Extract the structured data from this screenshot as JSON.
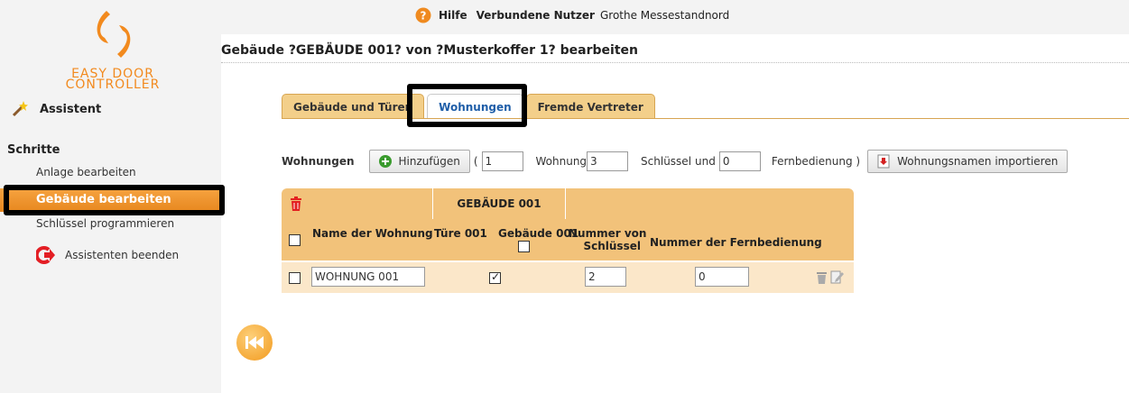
{
  "app": {
    "logo_line1": "EASY DOOR",
    "logo_line2": "CONTROLLER"
  },
  "sidebar": {
    "assistent_label": "Assistent",
    "schritte_label": "Schritte",
    "steps": [
      "Anlage bearbeiten",
      "Gebäude bearbeiten",
      "Schlüssel programmieren"
    ],
    "exit_label": "Assistenten beenden"
  },
  "topbar": {
    "help_label": "Hilfe",
    "users_label": "Verbundene Nutzer",
    "user_name": "Grothe Messestandnord"
  },
  "page": {
    "title": "Gebäude ?GEBÄUDE 001? von ?Musterkoffer 1? bearbeiten"
  },
  "tabs": [
    "Gebäude und Türen",
    "Wohnungen",
    "Fremde Vertreter"
  ],
  "active_tab": "Wohnungen",
  "wohnbar": {
    "label": "Wohnungen",
    "add_button": "Hinzufügen",
    "open_paren": "(",
    "wohnung_count": "1",
    "wohnung_label": "Wohnung",
    "schluessel_count": "3",
    "schluessel_label": "Schlüssel",
    "und_label": "und",
    "fernbedienung_count": "0",
    "fernbedienung_label": "Fernbedienung )",
    "import_button": "Wohnungsnamen importieren"
  },
  "table": {
    "group_header": "GEBÄUDE 001",
    "col_name": "Name der Wohnung",
    "col_tuere": "Türe 001",
    "col_gebaeude": "Gebäude 001",
    "col_schluessel_1": "Nummer von",
    "col_schluessel_2": "Schlüssel",
    "col_fernbedienung": "Nummer der Fernbedienung",
    "rows": [
      {
        "name": "WOHNUNG 001",
        "tuere_checked": true,
        "schluessel": "2",
        "fernbedienung": "0"
      }
    ]
  },
  "colors": {
    "accent": "#f2c27a",
    "sidebar_active": "#ec8d24",
    "tab_active_text": "#1f5ea8"
  }
}
